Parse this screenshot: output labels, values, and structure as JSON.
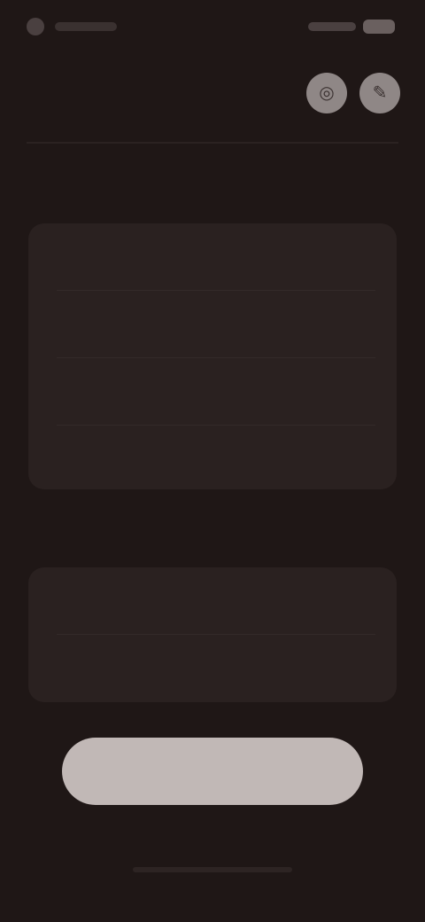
{
  "status_bar": {
    "time": "",
    "indicators": ""
  },
  "actions": {
    "left_icon": "◎",
    "right_icon": "✎"
  },
  "sections": [
    {
      "label": "",
      "rows": [
        {
          "label": "",
          "value": ""
        },
        {
          "label": "",
          "value": ""
        },
        {
          "label": "",
          "value": ""
        },
        {
          "label": "",
          "value": ""
        }
      ]
    },
    {
      "label": "",
      "rows": [
        {
          "label": "",
          "value": ""
        },
        {
          "label": "",
          "value": ""
        }
      ]
    }
  ],
  "primary_button": {
    "label": ""
  }
}
